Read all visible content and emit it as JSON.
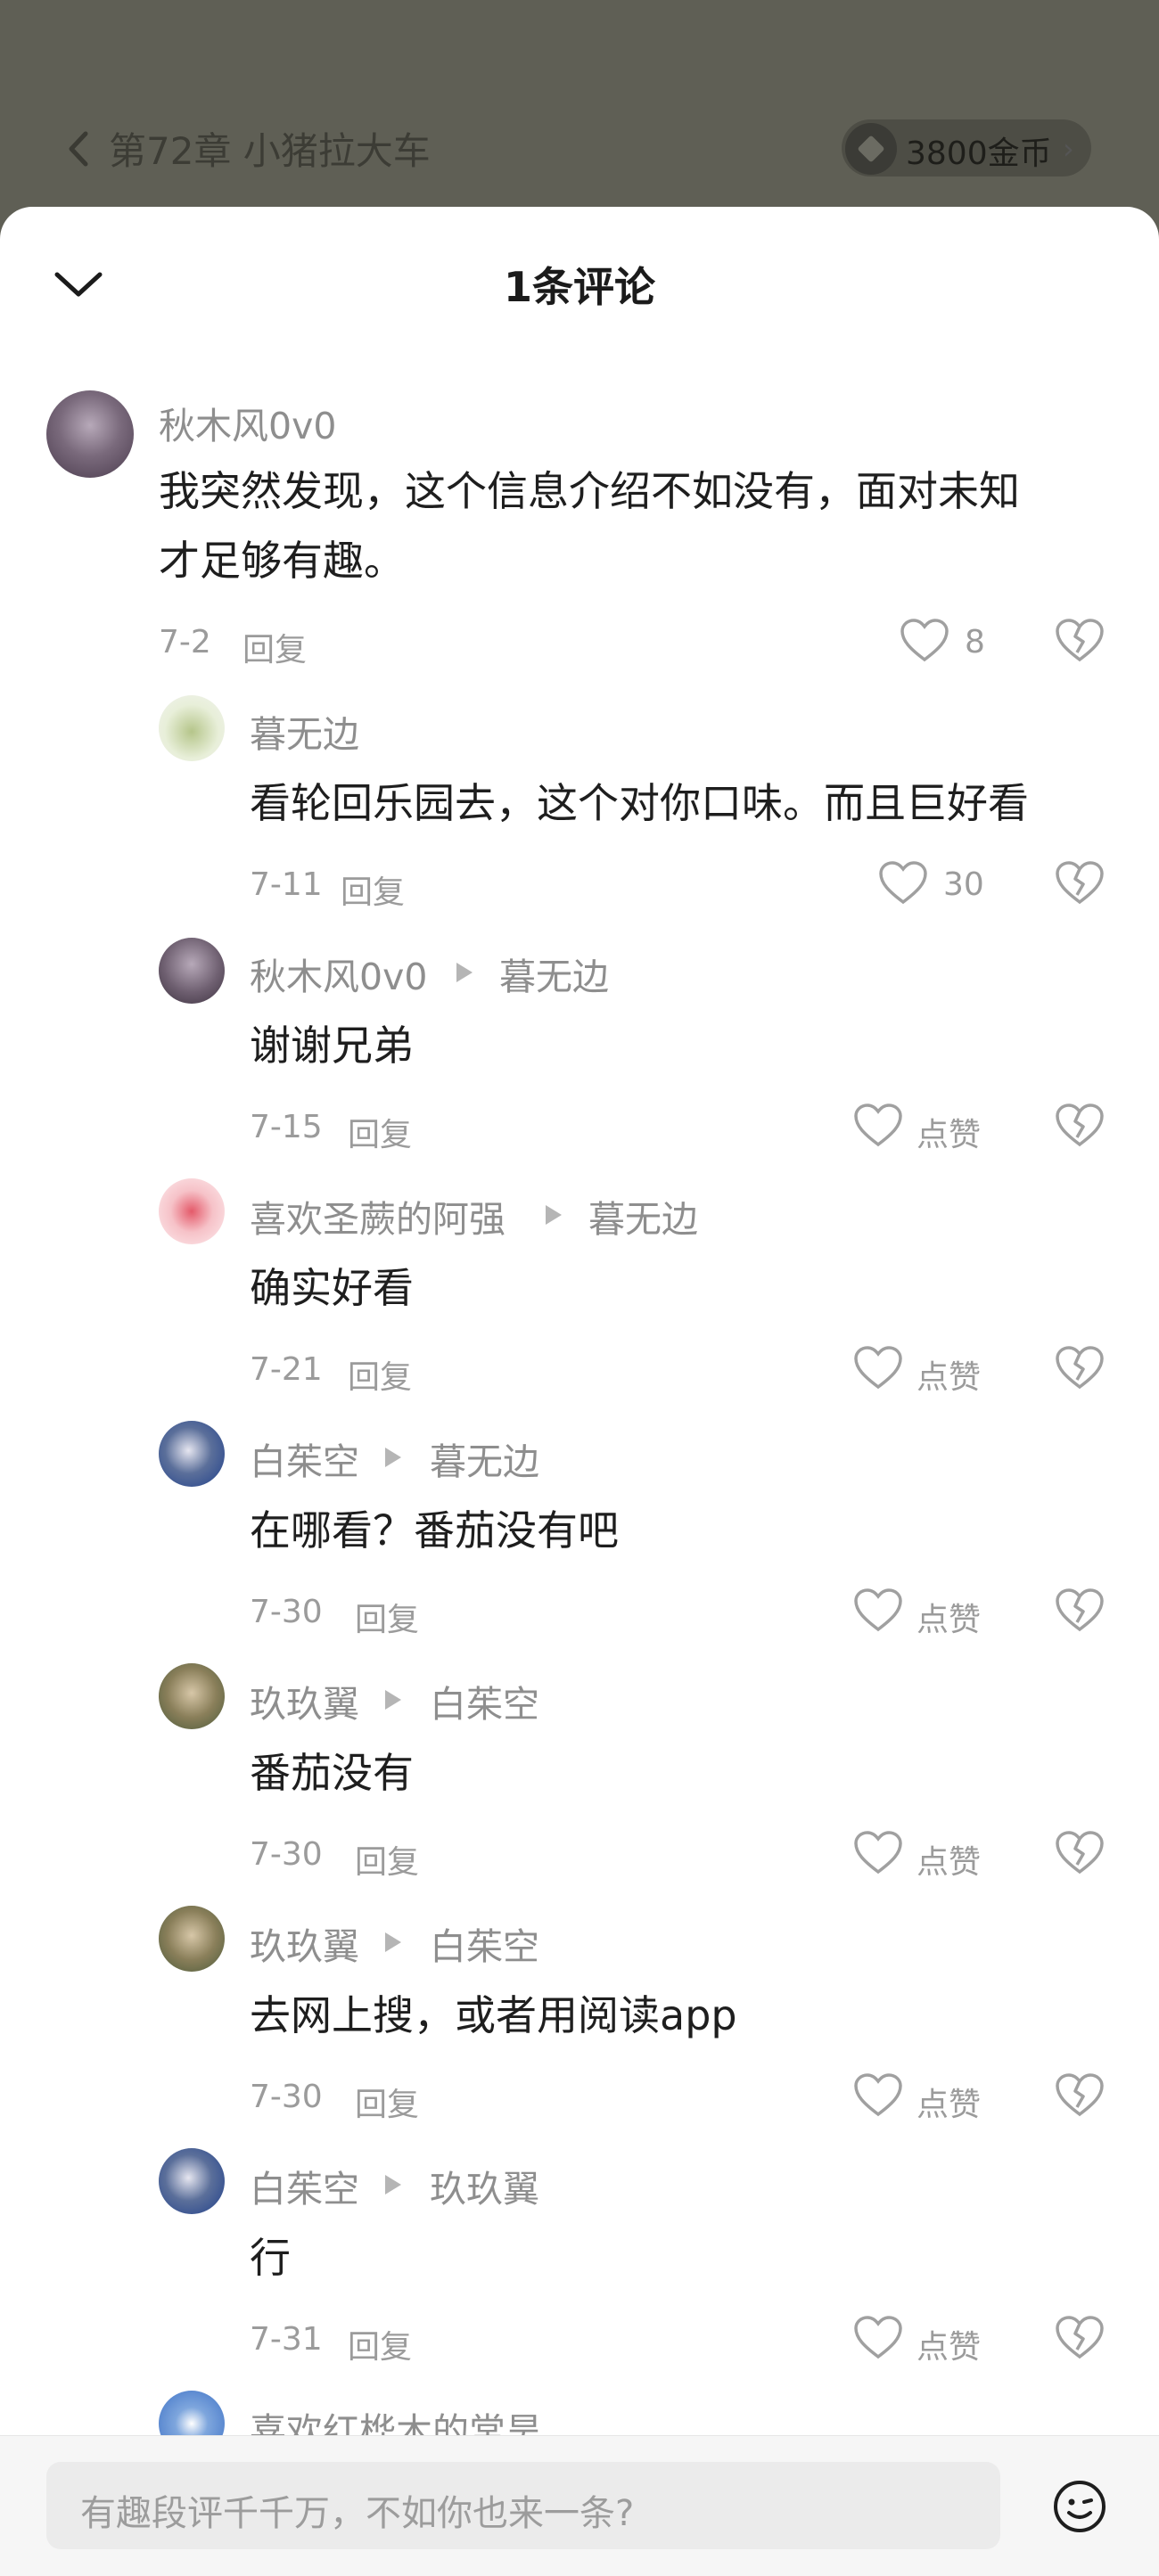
{
  "header": {
    "chapter_title": "第72章 小猪拉大车",
    "coins": "3800金币",
    "coins_arrow": "›"
  },
  "sheet": {
    "title": "1条评论"
  },
  "comment": {
    "user": "秋木风0v0",
    "text_line1": "我突然发现，这个信息介绍不如没有，面对未知",
    "text_line2": "才足够有趣。",
    "date": "7-2",
    "reply": "回复",
    "likes": "8"
  },
  "replies": [
    {
      "user": "暮无边",
      "target": "",
      "text": "看轮回乐园去，这个对你口味。而且巨好看",
      "date": "7-11",
      "reply": "回复",
      "likes": "30"
    },
    {
      "user": "秋木风0v0",
      "target": "暮无边",
      "text": "谢谢兄弟",
      "date": "7-15",
      "reply": "回复",
      "likes": "点赞"
    },
    {
      "user": "喜欢圣蕨的阿强",
      "target": "暮无边",
      "text": "确实好看",
      "date": "7-21",
      "reply": "回复",
      "likes": "点赞"
    },
    {
      "user": "白茱空",
      "target": "暮无边",
      "text": "在哪看？番茄没有吧",
      "date": "7-30",
      "reply": "回复",
      "likes": "点赞"
    },
    {
      "user": "玖玖翼",
      "target": "白茱空",
      "text": "番茄没有",
      "date": "7-30",
      "reply": "回复",
      "likes": "点赞"
    },
    {
      "user": "玖玖翼",
      "target": "白茱空",
      "text": "去网上搜，或者用阅读app",
      "date": "7-30",
      "reply": "回复",
      "likes": "点赞"
    },
    {
      "user": "白茱空",
      "target": "玖玖翼",
      "text": "行",
      "date": "7-31",
      "reply": "回复",
      "likes": "点赞"
    },
    {
      "user": "喜欢红桦木的常昊"
    }
  ],
  "input": {
    "placeholder": "有趣段评千千万，不如你也来一条?"
  }
}
